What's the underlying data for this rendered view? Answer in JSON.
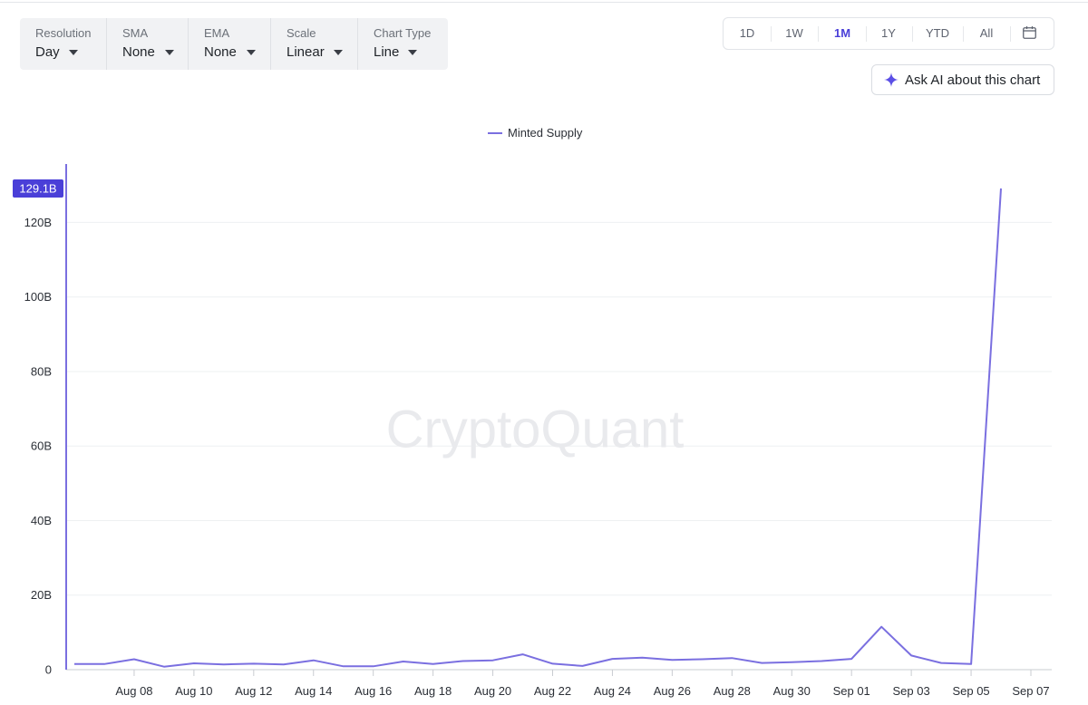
{
  "controls": [
    {
      "label": "Resolution",
      "value": "Day"
    },
    {
      "label": "SMA",
      "value": "None"
    },
    {
      "label": "EMA",
      "value": "None"
    },
    {
      "label": "Scale",
      "value": "Linear"
    },
    {
      "label": "Chart Type",
      "value": "Line"
    }
  ],
  "ranges": [
    "1D",
    "1W",
    "1M",
    "1Y",
    "YTD",
    "All"
  ],
  "active_range": "1M",
  "ask_ai_label": "Ask AI about this chart",
  "watermark": "CryptoQuant",
  "colors": {
    "line": "#7a6fe0",
    "accent": "#4a3fd8",
    "badge": "#4a3fd8"
  },
  "icons": {
    "calendar": "calendar-icon",
    "sparkle": "sparkle-icon",
    "caret": "caret-down-icon"
  },
  "chart_data": {
    "type": "line",
    "legend": "top-center",
    "grid": true,
    "series": [
      {
        "name": "Minted Supply",
        "x": [
          "2024-08-06",
          "2024-08-07",
          "2024-08-08",
          "2024-08-09",
          "2024-08-10",
          "2024-08-11",
          "2024-08-12",
          "2024-08-13",
          "2024-08-14",
          "2024-08-15",
          "2024-08-16",
          "2024-08-17",
          "2024-08-18",
          "2024-08-19",
          "2024-08-20",
          "2024-08-21",
          "2024-08-22",
          "2024-08-23",
          "2024-08-24",
          "2024-08-25",
          "2024-08-26",
          "2024-08-27",
          "2024-08-28",
          "2024-08-29",
          "2024-08-30",
          "2024-08-31",
          "2024-09-01",
          "2024-09-02",
          "2024-09-03",
          "2024-09-04",
          "2024-09-05",
          "2024-09-06"
        ],
        "values": [
          1.5,
          1.5,
          2.8,
          0.8,
          1.7,
          1.4,
          1.6,
          1.4,
          2.5,
          0.9,
          0.9,
          2.2,
          1.5,
          2.3,
          2.5,
          4.1,
          1.6,
          1.0,
          2.9,
          3.2,
          2.6,
          2.8,
          3.1,
          1.8,
          2.0,
          2.3,
          2.9,
          11.5,
          3.8,
          1.8,
          1.5,
          129.1
        ]
      }
    ],
    "x_ticks": [
      "Aug 08",
      "Aug 10",
      "Aug 12",
      "Aug 14",
      "Aug 16",
      "Aug 18",
      "Aug 20",
      "Aug 22",
      "Aug 24",
      "Aug 26",
      "Aug 28",
      "Aug 30",
      "Sep 01",
      "Sep 03",
      "Sep 05",
      "Sep 07"
    ],
    "x_tick_dates": [
      "2024-08-08",
      "2024-08-10",
      "2024-08-12",
      "2024-08-14",
      "2024-08-16",
      "2024-08-18",
      "2024-08-20",
      "2024-08-22",
      "2024-08-24",
      "2024-08-26",
      "2024-08-28",
      "2024-08-30",
      "2024-09-01",
      "2024-09-03",
      "2024-09-05",
      "2024-09-07"
    ],
    "xlim": [
      "2024-08-06",
      "2024-09-07"
    ],
    "y_ticks": [
      0,
      20,
      40,
      60,
      80,
      100,
      120
    ],
    "y_tick_labels": [
      "0",
      "20B",
      "40B",
      "60B",
      "80B",
      "100B",
      "120B"
    ],
    "ylim": [
      0,
      129.1
    ],
    "last_value_label": "129.1B",
    "last_value": 129.1
  }
}
